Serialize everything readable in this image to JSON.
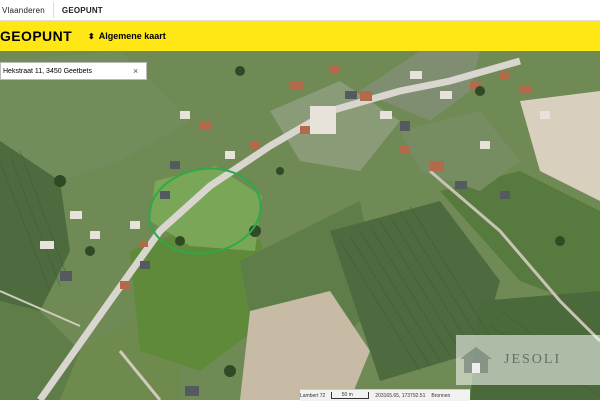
{
  "topbar": {
    "brand": "Vlaanderen",
    "app": "GEOPUNT"
  },
  "header": {
    "title": "GEOPUNT",
    "layer_label": "Algemene kaart"
  },
  "search": {
    "value": "Hekstraat 11, 3450 Geetbets",
    "clear_icon": "×"
  },
  "scalebar": {
    "projection": "Lambert 72",
    "distance": "50 m",
    "coordinates": "203165.65, 173792.51",
    "sources": "Bronnen"
  },
  "watermark": {
    "text": "JESOLI"
  },
  "colors": {
    "accent": "#ffe615",
    "highlight_circle": "#2ea84a"
  }
}
